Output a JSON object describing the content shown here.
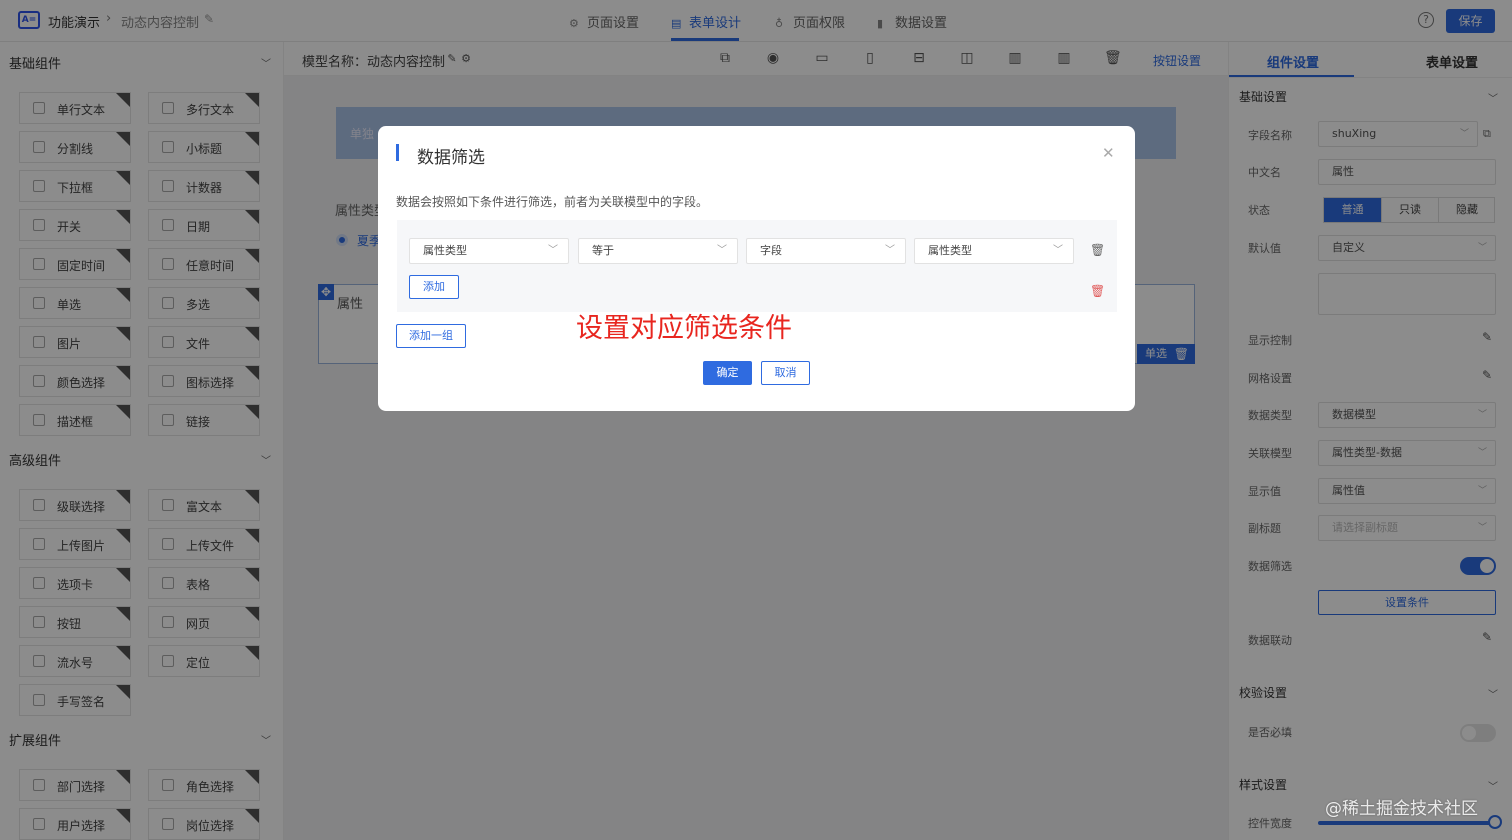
{
  "topbar": {
    "breadcrumb_root": "功能演示",
    "breadcrumb_sep": "›",
    "breadcrumb_page": "动态内容控制",
    "tabs": [
      {
        "label": "页面设置",
        "icon": "gear-icon"
      },
      {
        "label": "表单设计",
        "icon": "document-icon"
      },
      {
        "label": "页面权限",
        "icon": "key-icon"
      },
      {
        "label": "数据设置",
        "icon": "bar-chart-icon"
      }
    ],
    "active_tab": "表单设计",
    "save_label": "保存",
    "accent_color": "#2f6be0"
  },
  "left_panel": {
    "sections": [
      {
        "title": "基础组件",
        "items": [
          "单行文本",
          "多行文本",
          "分割线",
          "小标题",
          "下拉框",
          "计数器",
          "开关",
          "日期",
          "固定时间",
          "任意时间",
          "单选",
          "多选",
          "图片",
          "文件",
          "颜色选择",
          "图标选择",
          "描述框",
          "链接"
        ]
      },
      {
        "title": "高级组件",
        "items": [
          "级联选择",
          "富文本",
          "上传图片",
          "上传文件",
          "选项卡",
          "表格",
          "按钮",
          "网页",
          "流水号",
          "定位",
          "手写签名"
        ]
      },
      {
        "title": "扩展组件",
        "items": [
          "部门选择",
          "角色选择",
          "用户选择",
          "岗位选择"
        ]
      }
    ]
  },
  "canvas": {
    "model_label": "模型名称：动态内容控制",
    "button_settings": "按钮设置",
    "banner_text": "单独",
    "attr_label": "属性类型",
    "radio_label": "夏季",
    "field_label": "属性",
    "field_tag": "单选"
  },
  "right_panel": {
    "tabs": [
      "组件设置",
      "表单设置"
    ],
    "basic_section": "基础设置",
    "field_name_label": "字段名称",
    "field_name_value": "shuXing",
    "cn_name_label": "中文名",
    "cn_name_value": "属性",
    "state_label": "状态",
    "state_options": [
      "普通",
      "只读",
      "隐藏"
    ],
    "state_selected": "普通",
    "default_label": "默认值",
    "default_value": "自定义",
    "display_control_label": "显示控制",
    "grid_label": "网格设置",
    "data_type_label": "数据类型",
    "data_type_value": "数据模型",
    "rel_model_label": "关联模型",
    "rel_model_value": "属性类型-数据",
    "display_value_label": "显示值",
    "display_value_value": "属性值",
    "subtitle_label": "副标题",
    "subtitle_placeholder": "请选择副标题",
    "data_filter_label": "数据筛选",
    "data_filter_on": true,
    "set_cond_button": "设置条件",
    "data_link_label": "数据联动",
    "validation_section": "校验设置",
    "required_label": "是否必填",
    "required_on": false,
    "style_section": "样式设置",
    "width_label": "控件宽度",
    "width_fraction": 1.0
  },
  "modal": {
    "title": "数据筛选",
    "description": "数据会按照如下条件进行筛选，前者为关联模型中的字段。",
    "condition": [
      "属性类型",
      "等于",
      "字段",
      "属性类型"
    ],
    "add_label": "添加",
    "add_group_label": "添加一组",
    "ok_label": "确定",
    "cancel_label": "取消",
    "annotation": "设置对应筛选条件",
    "annotation_color": "#e8261f"
  },
  "watermark": "@稀土掘金技术社区"
}
